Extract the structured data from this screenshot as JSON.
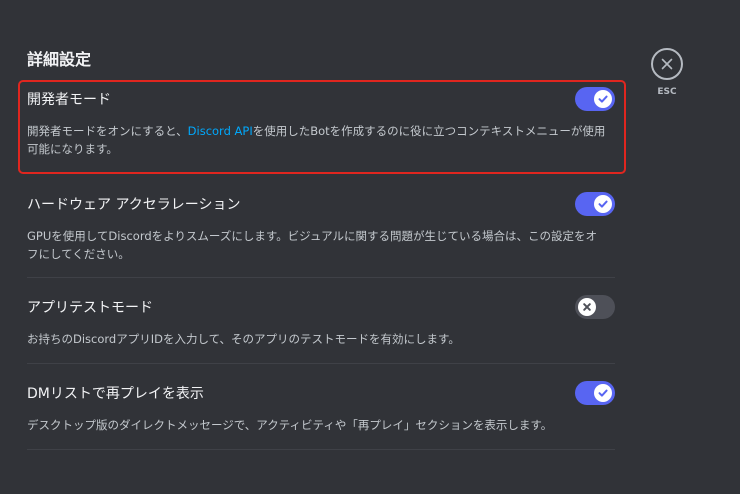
{
  "section": {
    "title": "詳細設定"
  },
  "esc": {
    "label": "ESC"
  },
  "settings": [
    {
      "label": "開発者モード",
      "desc_before": "開発者モードをオンにすると、",
      "desc_link": "Discord API",
      "desc_after": "を使用したBotを作成するのに役に立つコンテキストメニューが使用可能になります。",
      "state": "on"
    },
    {
      "label": "ハードウェア アクセラレーション",
      "desc": "GPUを使用してDiscordをよりスムーズにします。ビジュアルに関する問題が生じている場合は、この設定をオフにしてください。",
      "state": "on"
    },
    {
      "label": "アプリテストモード",
      "desc": "お持ちのDiscordアプリIDを入力して、そのアプリのテストモードを有効にします。",
      "state": "off"
    },
    {
      "label": "DMリストで再プレイを表示",
      "desc": "デスクトップ版のダイレクトメッセージで、アクティビティや「再プレイ」セクションを表示します。",
      "state": "on"
    }
  ],
  "colors": {
    "background": "#313338",
    "toggle_on": "#5865f2",
    "toggle_off": "#4e5058",
    "link": "#00a8fc",
    "highlight": "#e0261f"
  }
}
